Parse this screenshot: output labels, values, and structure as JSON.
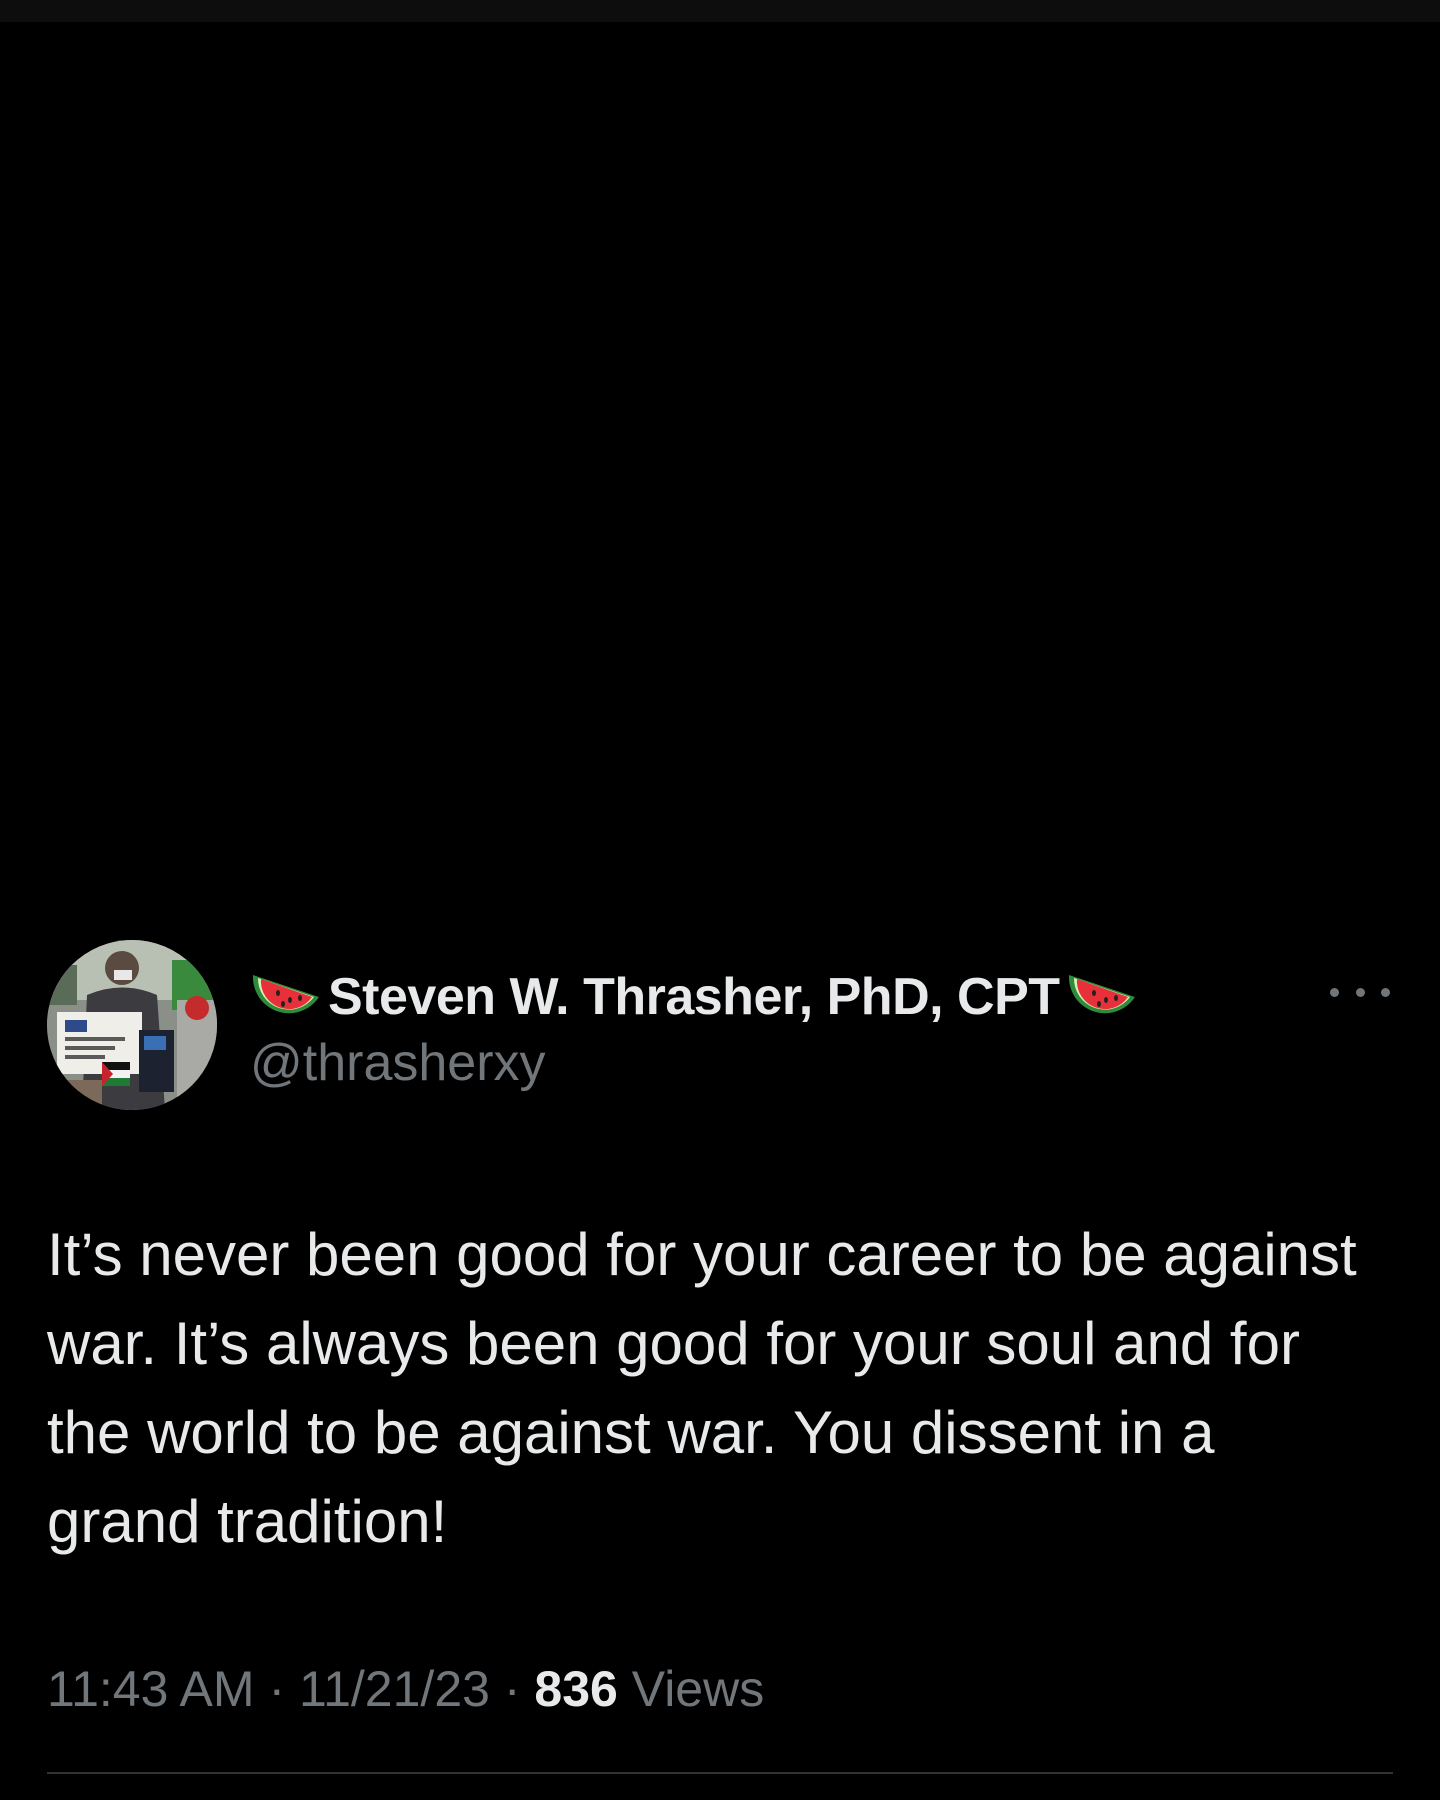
{
  "tweet": {
    "display_name": "Steven W. Thrasher, PhD, CPT",
    "name_prefix_icon": "watermelon-emoji",
    "name_suffix_icon": "watermelon-emoji",
    "handle": "@thrasherxy",
    "more_icon": "more-options-icon",
    "text": "It’s never been good for your career to be against war. It’s always been good for your soul and for the world to be against war. You dissent in a grand tradition!",
    "time": "11:43 AM",
    "separator": "·",
    "date": "11/21/23",
    "views_count": "836",
    "views_label": "Views"
  },
  "colors": {
    "background": "#000000",
    "primary_text": "#e7e9ea",
    "secondary_text": "#71767b",
    "divider": "#2f3336"
  }
}
